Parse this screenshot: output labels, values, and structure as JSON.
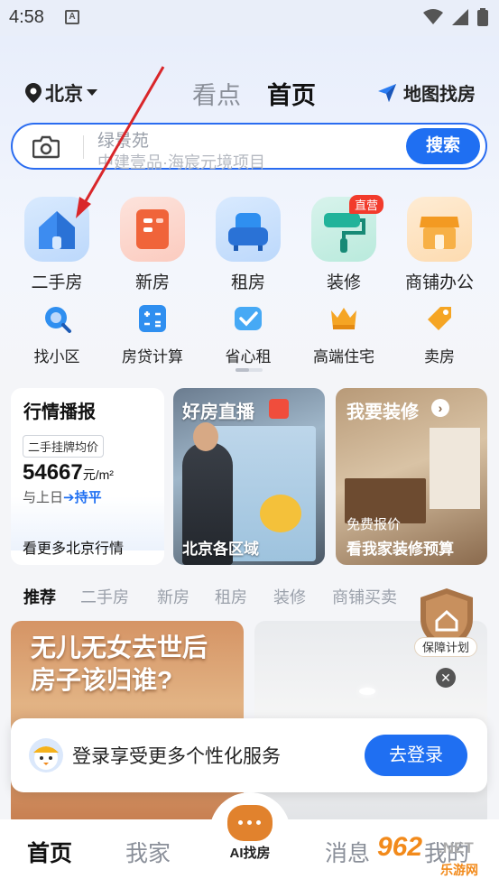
{
  "status_bar": {
    "time": "4:58",
    "notif_icon_letter": "A"
  },
  "header": {
    "city": "北京",
    "tabs": [
      {
        "label": "看点"
      },
      {
        "label": "首页"
      }
    ],
    "map_find": "地图找房"
  },
  "search": {
    "placeholder_line1": "绿景苑",
    "placeholder_line2": "中建壹品·海宸元境项目",
    "button": "搜索"
  },
  "categories": [
    {
      "label": "二手房",
      "icon": "house-icon",
      "color": "#3d8cf0"
    },
    {
      "label": "新房",
      "icon": "building-icon",
      "color": "#f0643a"
    },
    {
      "label": "租房",
      "icon": "sofa-icon",
      "color": "#2f8ff0"
    },
    {
      "label": "装修",
      "icon": "paint-roller-icon",
      "color": "#21b39a",
      "badge": "直营"
    },
    {
      "label": "商铺办公",
      "icon": "shop-icon",
      "color": "#f39a22"
    }
  ],
  "subcategories": [
    {
      "label": "找小区",
      "icon": "community-search-icon"
    },
    {
      "label": "房贷计算",
      "icon": "calculator-icon"
    },
    {
      "label": "省心租",
      "icon": "check-heart-icon"
    },
    {
      "label": "高端住宅",
      "icon": "crown-icon"
    },
    {
      "label": "卖房",
      "icon": "price-tag-icon"
    }
  ],
  "market_card": {
    "title": "行情播报",
    "tag": "二手挂牌均价",
    "price": "54667",
    "unit": "元/m²",
    "compare_prefix": "与上日",
    "compare_value": "持平",
    "more": "看更多北京行情"
  },
  "live_card": {
    "title": "好房直播",
    "subtitle": "北京各区域"
  },
  "deco_card": {
    "title": "我要装修",
    "line1": "免费报价",
    "line2": "看我家装修预算"
  },
  "rec_tabs": [
    "推荐",
    "二手房",
    "新房",
    "租房",
    "装修",
    "商铺买卖"
  ],
  "guarantee": "保障计划",
  "rec_card1_text": [
    "无儿无女去世后",
    "房子该归谁?"
  ],
  "login_banner": {
    "text": "登录享受更多个性化服务",
    "button": "去登录"
  },
  "bottom_nav": {
    "home": "首页",
    "mine": "我家",
    "ai": "AI找房",
    "msg": "消息",
    "me": "我的"
  },
  "watermark": {
    "num": "962",
    "net": ".NET",
    "cn": "乐游网"
  },
  "colors": {
    "accent": "#1f6ff2",
    "annotation_arrow": "#d9262a"
  }
}
